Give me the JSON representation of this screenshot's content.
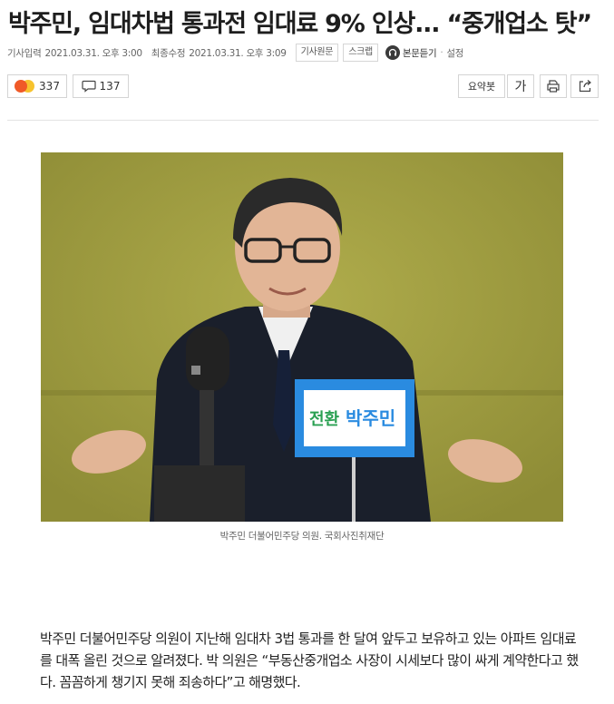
{
  "article": {
    "title": "박주민, 임대차법 통과전 임대료 9% 인상... “중개업소 탓”",
    "meta": {
      "published_label": "기사입력",
      "published": "2021.03.31. 오후 3:00",
      "modified_label": "최종수정",
      "modified": "2021.03.31. 오후 3:09",
      "original_button": "기사원문",
      "scrap_button": "스크랩",
      "listen_label": "본문듣기",
      "separator": "·",
      "settings_label": "설정"
    },
    "toolbar": {
      "reaction_count": "337",
      "comment_count": "137",
      "summary_label": "요약봇",
      "font_label": "가"
    },
    "photo": {
      "placard_line1": "전환",
      "placard_line2": "박주민",
      "caption": "박주민 더불어민주당 의원. 국회사진취재단"
    },
    "body": "박주민 더불어민주당 의원이 지난해 임대차 3법 통과를 한 달여 앞두고 보유하고 있는 아파트 임대료를 대폭 올린 것으로 알려졌다. 박 의원은 “부동산중개업소 사장이 시세보다 많이 싸게 계약한다고 했다. 꼼꼼하게 챙기지 못해 죄송하다”고 해명했다."
  },
  "colors": {
    "reaction_angry": "#f05a28",
    "reaction_smile": "#f7c32e",
    "placard_blue": "#2a8be0",
    "placard_green": "#2aa052",
    "backdrop": "#a5a244"
  },
  "icons": [
    "angry-emoji-icon",
    "smile-emoji-icon",
    "comment-icon",
    "print-icon",
    "share-icon",
    "headphones-icon"
  ]
}
